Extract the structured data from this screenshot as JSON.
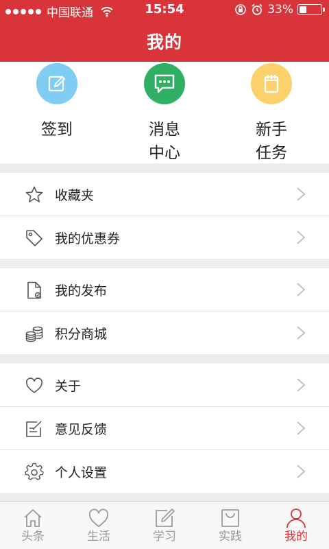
{
  "status": {
    "carrier": "中国联通",
    "time": "15:54",
    "battery": "33%",
    "battery_level": 0.33
  },
  "nav": {
    "title": "我的"
  },
  "colors": {
    "header": "#d8343a",
    "checkin": "#7fcdf2",
    "message": "#2fb064",
    "task": "#fcd06a",
    "tab_active": "#d8343a",
    "tab_inactive": "#9a9a9a"
  },
  "quick_actions": [
    {
      "label": "签到",
      "icon": "edit-icon"
    },
    {
      "label": "消息\n中心",
      "line1": "消息",
      "line2": "中心",
      "icon": "chat-icon"
    },
    {
      "label": "新手\n任务",
      "line1": "新手",
      "line2": "任务",
      "icon": "notepad-icon"
    }
  ],
  "menu": {
    "favorites": {
      "label": "收藏夹",
      "icon": "star-icon"
    },
    "coupons": {
      "label": "我的优惠券",
      "icon": "tag-icon"
    },
    "posts": {
      "label": "我的发布",
      "icon": "document-icon"
    },
    "points_mall": {
      "label": "积分商城",
      "icon": "coins-icon"
    },
    "about": {
      "label": "关于",
      "icon": "heart-icon"
    },
    "feedback": {
      "label": "意见反馈",
      "icon": "note-edit-icon"
    },
    "settings": {
      "label": "个人设置",
      "icon": "gear-icon"
    }
  },
  "tabs": [
    {
      "label": "头条",
      "icon": "home-icon"
    },
    {
      "label": "生活",
      "icon": "heart-icon"
    },
    {
      "label": "学习",
      "icon": "pencil-icon"
    },
    {
      "label": "实践",
      "icon": "bag-icon"
    },
    {
      "label": "我的",
      "icon": "person-icon",
      "active": true
    }
  ]
}
